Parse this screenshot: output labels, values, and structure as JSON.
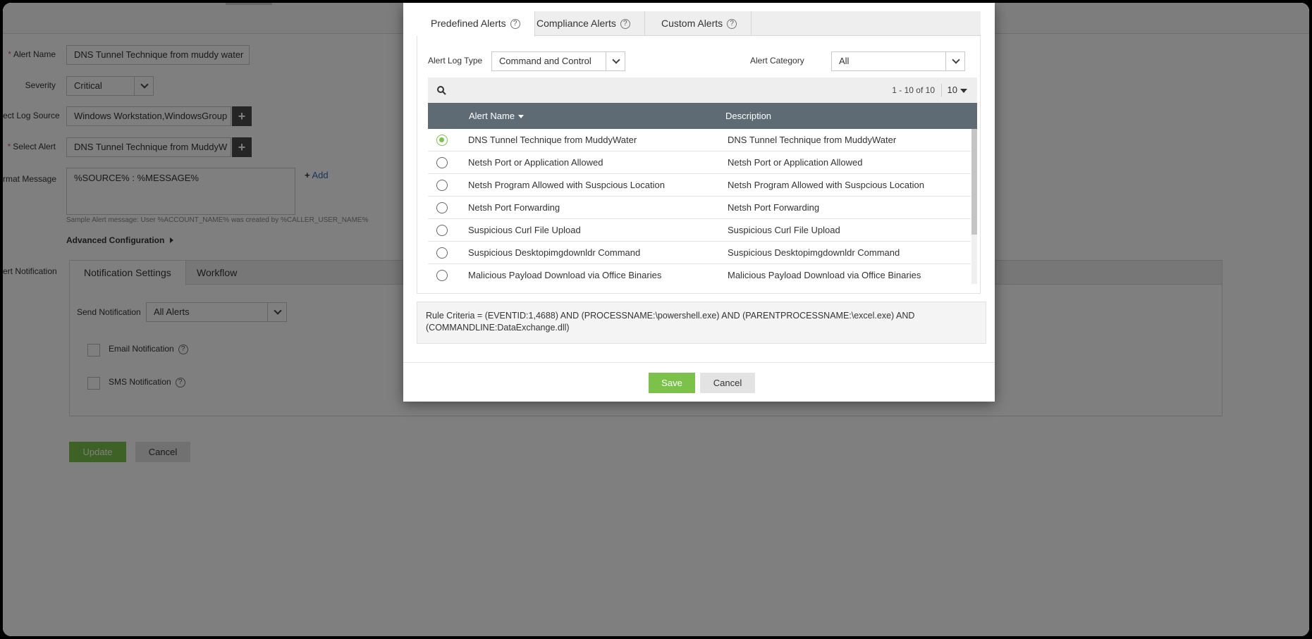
{
  "form": {
    "alert_name_label": "Alert Name",
    "alert_name_value": "DNS Tunnel Technique from muddy water",
    "severity_label": "Severity",
    "severity_value": "Critical",
    "log_source_label": "ect Log Source",
    "log_source_value": "Windows Workstation,WindowsGroup",
    "select_alert_label": "Select Alert",
    "select_alert_value": "DNS Tunnel Technique from MuddyW",
    "format_message_label": "rmat Message",
    "format_message_value": "%SOURCE% : %MESSAGE%",
    "add_link": "Add",
    "sample_message": "Sample Alert message: User %ACCOUNT_NAME% was created by %CALLER_USER_NAME%",
    "advanced_config": "Advanced Configuration",
    "alert_notification_label": "ert Notification",
    "update_button": "Update",
    "cancel_button": "Cancel"
  },
  "notification": {
    "tabs": [
      "Notification Settings",
      "Workflow"
    ],
    "send_label": "Send Notification",
    "send_value": "All Alerts",
    "email_label": "Email Notification",
    "sms_label": "SMS Notification"
  },
  "modal": {
    "tabs": [
      "Predefined Alerts",
      "Compliance Alerts",
      "Custom Alerts"
    ],
    "log_type_label": "Alert Log Type",
    "log_type_value": "Command and Control",
    "category_label": "Alert Category",
    "category_value": "All",
    "pager": "1 - 10 of 10",
    "per_page": "10",
    "col_name": "Alert Name",
    "col_desc": "Description",
    "rows": [
      {
        "name": "DNS Tunnel Technique from MuddyWater",
        "desc": "DNS Tunnel Technique from MuddyWater",
        "selected": true
      },
      {
        "name": "Netsh Port or Application Allowed",
        "desc": "Netsh Port or Application Allowed",
        "selected": false
      },
      {
        "name": "Netsh Program Allowed with Suspcious Location",
        "desc": "Netsh Program Allowed with Suspcious Location",
        "selected": false
      },
      {
        "name": "Netsh Port Forwarding",
        "desc": "Netsh Port Forwarding",
        "selected": false
      },
      {
        "name": "Suspicious Curl File Upload",
        "desc": "Suspicious Curl File Upload",
        "selected": false
      },
      {
        "name": "Suspicious Desktopimgdownldr Command",
        "desc": "Suspicious Desktopimgdownldr Command",
        "selected": false
      },
      {
        "name": "Malicious Payload Download via Office Binaries",
        "desc": "Malicious Payload Download via Office Binaries",
        "selected": false
      }
    ],
    "rule_criteria": "Rule Criteria = (EVENTID:1,4688) AND (PROCESSNAME:\\powershell.exe) AND (PARENTPROCESSNAME:\\excel.exe) AND (COMMANDLINE:DataExchange.dll)",
    "save_button": "Save",
    "cancel_button": "Cancel"
  },
  "icons": {
    "help": "?",
    "plus": "+"
  },
  "colors": {
    "accent_green": "#7cc24a",
    "table_header": "#5f6b74"
  }
}
